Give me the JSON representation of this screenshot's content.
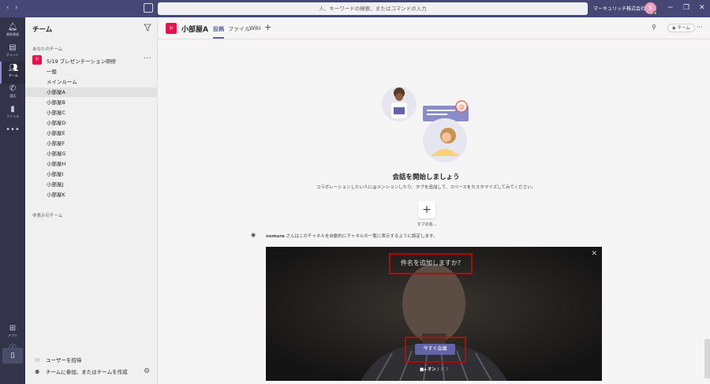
{
  "topbar": {
    "search_placeholder": "人、キーワードの検索、またはコマンドの入力",
    "org_name": "マーキュリッチ株式会社",
    "avatar_initial": "S"
  },
  "rail": {
    "items": [
      {
        "label": "最新情報",
        "icon": "bell-icon"
      },
      {
        "label": "チャット",
        "icon": "chat-icon"
      },
      {
        "label": "チーム",
        "icon": "teams-icon"
      },
      {
        "label": "通話",
        "icon": "phone-icon"
      },
      {
        "label": "ファイル",
        "icon": "file-icon"
      },
      {
        "label": "アプリ",
        "icon": "apps-icon"
      },
      {
        "label": "ヘルプ",
        "icon": "help-icon"
      }
    ]
  },
  "teams_panel": {
    "title": "チーム",
    "section_yours": "あなたのチーム",
    "team": {
      "badge": "5/",
      "name": "5/19 プレゼンテーション研修"
    },
    "channels": [
      "一般",
      "メインルーム",
      "小部屋A",
      "小部屋B",
      "小部屋C",
      "小部屋D",
      "小部屋E",
      "小部屋F",
      "小部屋G",
      "小部屋H",
      "小部屋I",
      "小部屋J",
      "小部屋K"
    ],
    "section_hidden": "非表示のチーム",
    "invite": "ユーザーを招待",
    "join_or_create": "チームに参加、またはチームを作成"
  },
  "channel_header": {
    "badge": "5/",
    "title": "小部屋A",
    "tabs": [
      "投稿",
      "ファイル",
      "Wiki"
    ],
    "team_button": "チーム"
  },
  "empty_state": {
    "title": "会話を開始しましょう",
    "subtitle": "コラボレーションしたい人に@メンションしたり、タブを追加して、スペースをカスタマイズしてみてください。",
    "add_tab_label": "タブの追..."
  },
  "notice": {
    "user": "nomura",
    "text": "さんはこのチャネルを自動的にチャネルの一覧に表示するように設定します。"
  },
  "meeting": {
    "subject_placeholder": "件名を追加しますか?",
    "meet_now": "今すぐ会議",
    "camera_on": "オン",
    "camera_sep": "/",
    "camera_off": "オフ",
    "highlight_color": "#c00000"
  }
}
